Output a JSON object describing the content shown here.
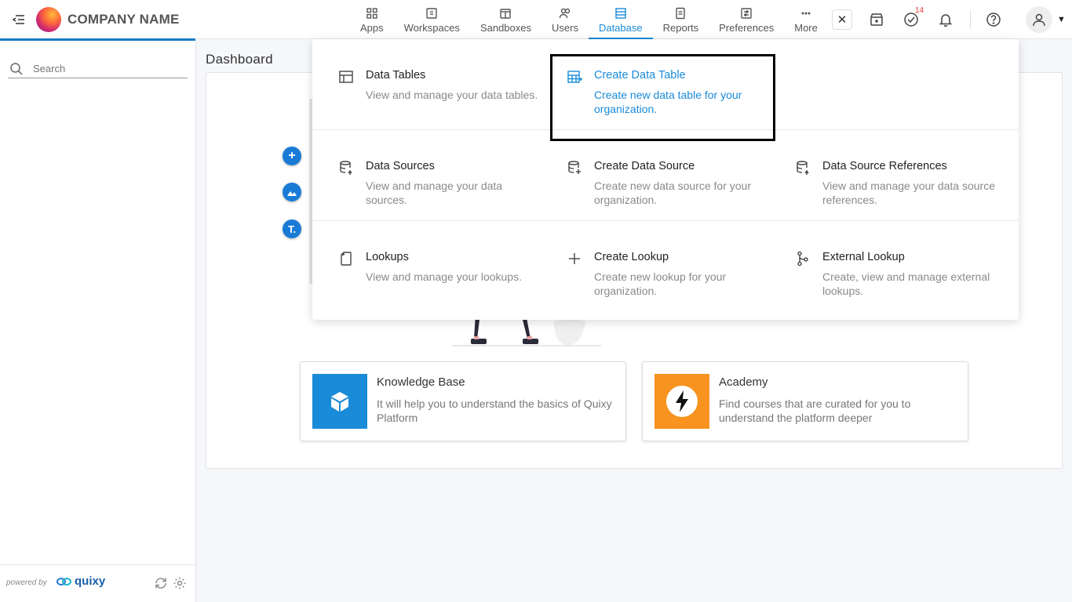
{
  "header": {
    "company_name": "COMPANY NAME",
    "nav": [
      {
        "label": "Apps",
        "icon": "grid-icon"
      },
      {
        "label": "Workspaces",
        "icon": "workspace-icon"
      },
      {
        "label": "Sandboxes",
        "icon": "sandbox-icon"
      },
      {
        "label": "Users",
        "icon": "users-icon"
      },
      {
        "label": "Database",
        "icon": "database-icon",
        "active": true
      },
      {
        "label": "Reports",
        "icon": "report-icon"
      },
      {
        "label": "Preferences",
        "icon": "preferences-icon"
      },
      {
        "label": "More",
        "icon": "more-icon"
      }
    ],
    "close_label": "✕",
    "tasks_badge": "14",
    "accent_color": "#1a8bd8"
  },
  "sidebar": {
    "search_placeholder": "Search",
    "powered_by": "powered by",
    "brand": "quixy"
  },
  "main": {
    "page_title": "Dashboard",
    "cards": [
      {
        "title": "Knowledge Base",
        "description": "It will help you to understand the basics of Quixy Platform",
        "color": "#1a8bd8"
      },
      {
        "title": "Academy",
        "description": "Find courses that are curated for you to understand the platform deeper",
        "color": "#f7931e"
      }
    ]
  },
  "dropdown": {
    "rows": [
      [
        {
          "label": "Data Tables",
          "sub": "View and manage your data tables.",
          "icon": "table-icon"
        },
        {
          "label": "Create Data Table",
          "sub": "Create new data table for your organization.",
          "icon": "table-add-icon",
          "highlight": true
        }
      ],
      [
        {
          "label": "Data Sources",
          "sub": "View and manage your data sources.",
          "icon": "data-source-icon"
        },
        {
          "label": "Create Data Source",
          "sub": "Create new data source for your organization.",
          "icon": "data-source-add-icon"
        },
        {
          "label": "Data Source References",
          "sub": "View and manage your data source references.",
          "icon": "data-source-ref-icon"
        }
      ],
      [
        {
          "label": "Lookups",
          "sub": "View and manage your lookups.",
          "icon": "lookup-icon"
        },
        {
          "label": "Create Lookup",
          "sub": "Create new lookup for your organization.",
          "icon": "plus-icon"
        },
        {
          "label": "External Lookup",
          "sub": "Create, view and manage external lookups.",
          "icon": "external-lookup-icon"
        }
      ]
    ]
  }
}
